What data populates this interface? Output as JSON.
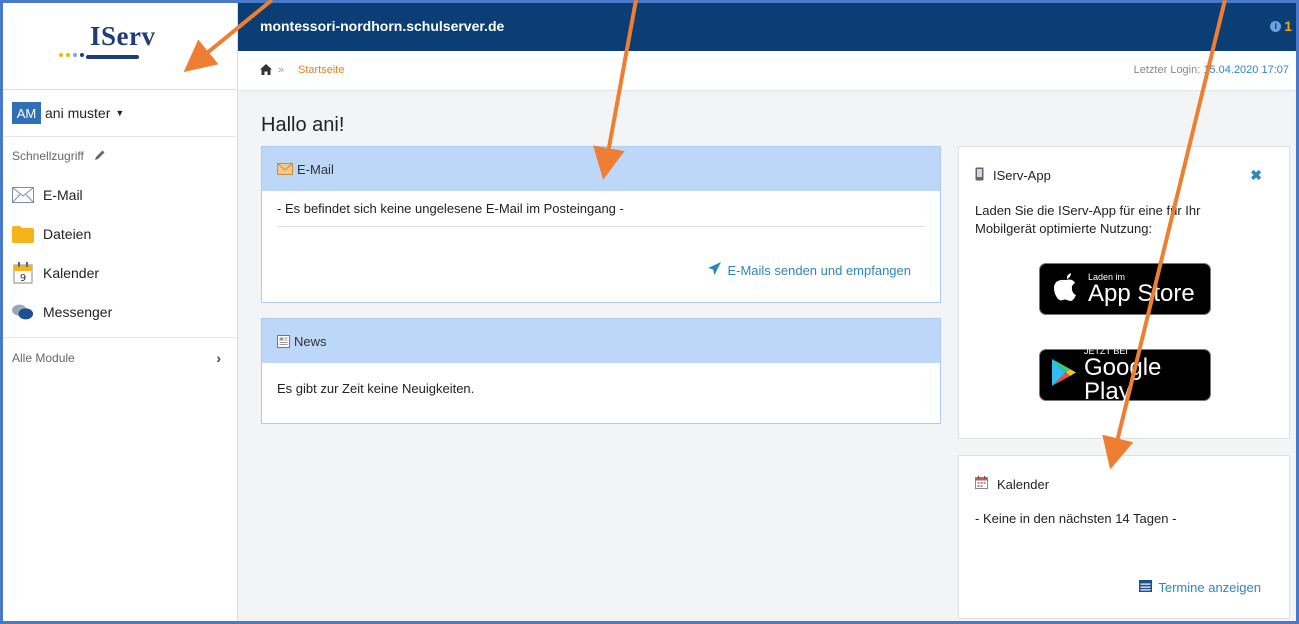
{
  "sidebar": {
    "logo_text": "IServ",
    "user": {
      "initials": "AM",
      "name": "ani muster"
    },
    "quick_access_label": "Schnellzugriff",
    "items": [
      {
        "label": "E-Mail",
        "icon": "mail-icon"
      },
      {
        "label": "Dateien",
        "icon": "folder-icon"
      },
      {
        "label": "Kalender",
        "icon": "calendar-icon"
      },
      {
        "label": "Messenger",
        "icon": "chat-bubbles-icon"
      }
    ],
    "all_modules_label": "Alle Module"
  },
  "header": {
    "domain": "montessori-nordhorn.schulserver.de",
    "notification_count": "1"
  },
  "breadcrumb": {
    "separator": "»",
    "current": "Startseite",
    "last_login_label": "Letzter Login:",
    "last_login_value": "15.04.2020 17:07"
  },
  "main": {
    "greeting": "Hallo ani!",
    "email_panel": {
      "title": "E-Mail",
      "message": "- Es befindet sich keine ungelesene E-Mail im Posteingang -",
      "link": "E-Mails senden und empfangen"
    },
    "news_panel": {
      "title": "News",
      "message": "Es gibt zur Zeit keine Neuigkeiten."
    },
    "app_card": {
      "title": "IServ-App",
      "text": "Laden Sie die IServ-App für eine für Ihr Mobilgerät optimierte Nutzung:",
      "appstore_small": "Laden im",
      "appstore_big": "App Store",
      "googleplay_small": "JETZT BEI",
      "googleplay_big": "Google Play"
    },
    "calendar_card": {
      "title": "Kalender",
      "message": "- Keine in den nächsten 14 Tagen -",
      "link": "Termine anzeigen"
    }
  },
  "colors": {
    "header_bg": "#0b3e74",
    "panel_head_bg": "#bcd7f7",
    "link": "#2e86c1",
    "breadcrumb_link": "#e67e22",
    "annotation_arrow": "#ee7e32"
  }
}
